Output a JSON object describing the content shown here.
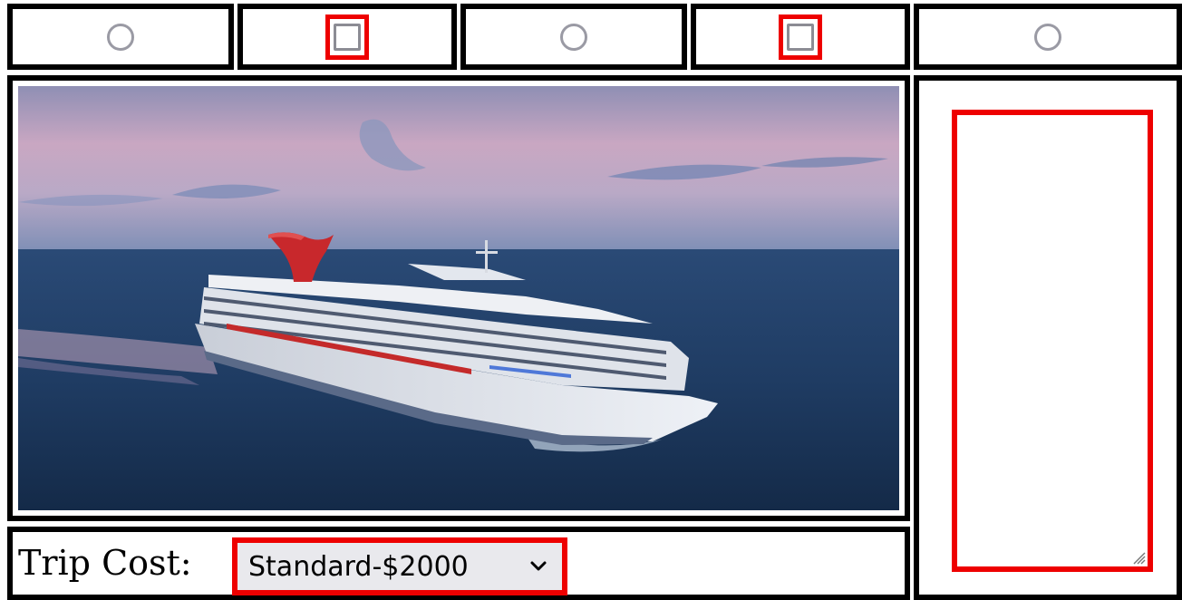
{
  "top_row": {
    "controls": [
      {
        "kind": "radio",
        "checked": false
      },
      {
        "kind": "checkbox",
        "checked": false,
        "highlighted": true
      },
      {
        "kind": "radio",
        "checked": false
      },
      {
        "kind": "checkbox",
        "checked": false,
        "highlighted": true
      },
      {
        "kind": "radio",
        "checked": false
      }
    ]
  },
  "photo": {
    "subject": "cruise ship at sea",
    "icon": "photo-image"
  },
  "side": {
    "textarea_value": "",
    "highlighted": true
  },
  "trip_cost": {
    "label": "Trip Cost:",
    "selected": "Standard-$2000",
    "highlighted": true
  },
  "colors": {
    "border": "#000000",
    "highlight": "#ee0000",
    "control_gray": "#9a9aa4",
    "select_bg": "#e9e9ed"
  }
}
